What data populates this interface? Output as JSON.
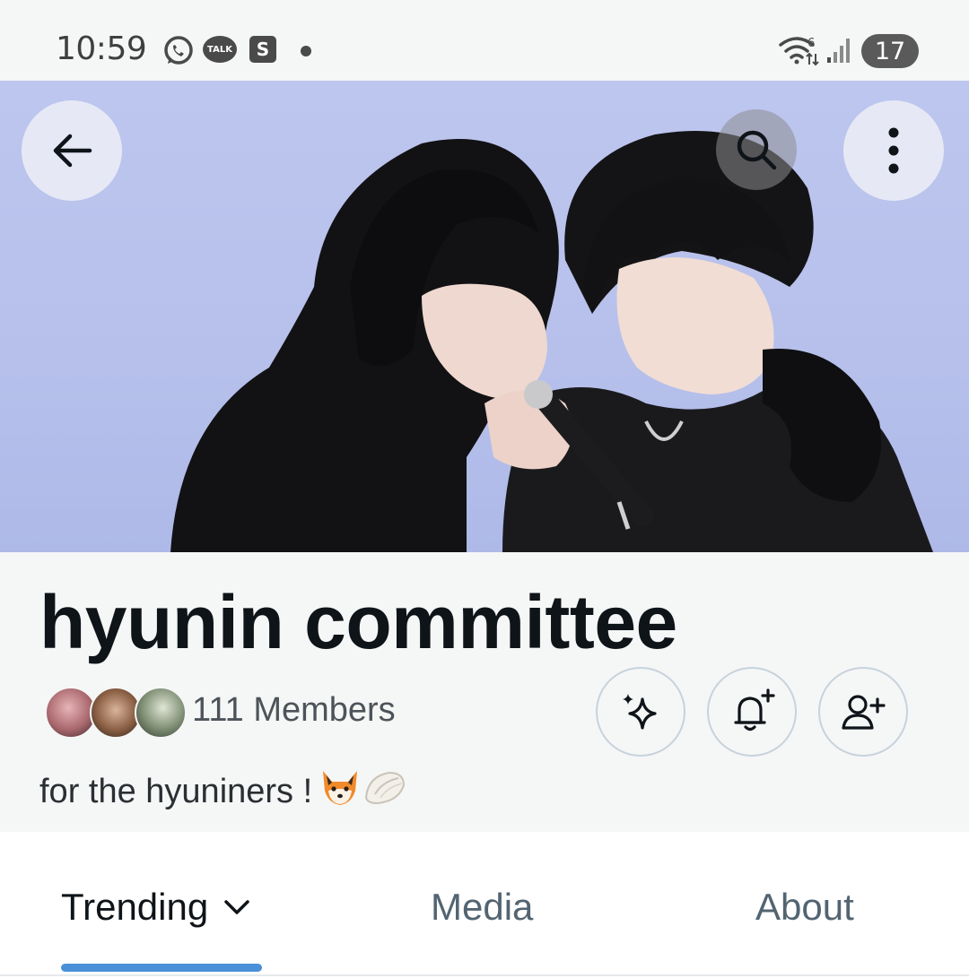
{
  "status_bar": {
    "time": "10:59",
    "icons": [
      "whatsapp-icon",
      "kakaotalk-icon",
      "s-app-icon",
      "notification-dot-icon",
      "wifi-icon",
      "signal-icon"
    ],
    "talk_label": "TALK",
    "s_label": "S",
    "battery": "17"
  },
  "header": {
    "back_icon": "arrow-left-icon",
    "search_icon": "search-icon",
    "more_icon": "more-vertical-icon"
  },
  "community": {
    "name": "hyunin committee",
    "members_label": "111 Members",
    "description": "for the hyuniners !",
    "description_emojis": [
      "fox-face-emoji",
      "dumpling-emoji"
    ],
    "actions": [
      "sparkle-icon",
      "bell-plus-icon",
      "person-plus-icon"
    ]
  },
  "tabs": [
    {
      "label": "Trending",
      "active": true,
      "icon": "chevron-down-icon"
    },
    {
      "label": "Media",
      "active": false
    },
    {
      "label": "About",
      "active": false
    }
  ],
  "colors": {
    "accent": "#4a90d9",
    "title": "#0f1419",
    "secondary_text": "#536471",
    "panel_bg": "#f5f6f6",
    "banner_bg": "#b6c0eb"
  }
}
